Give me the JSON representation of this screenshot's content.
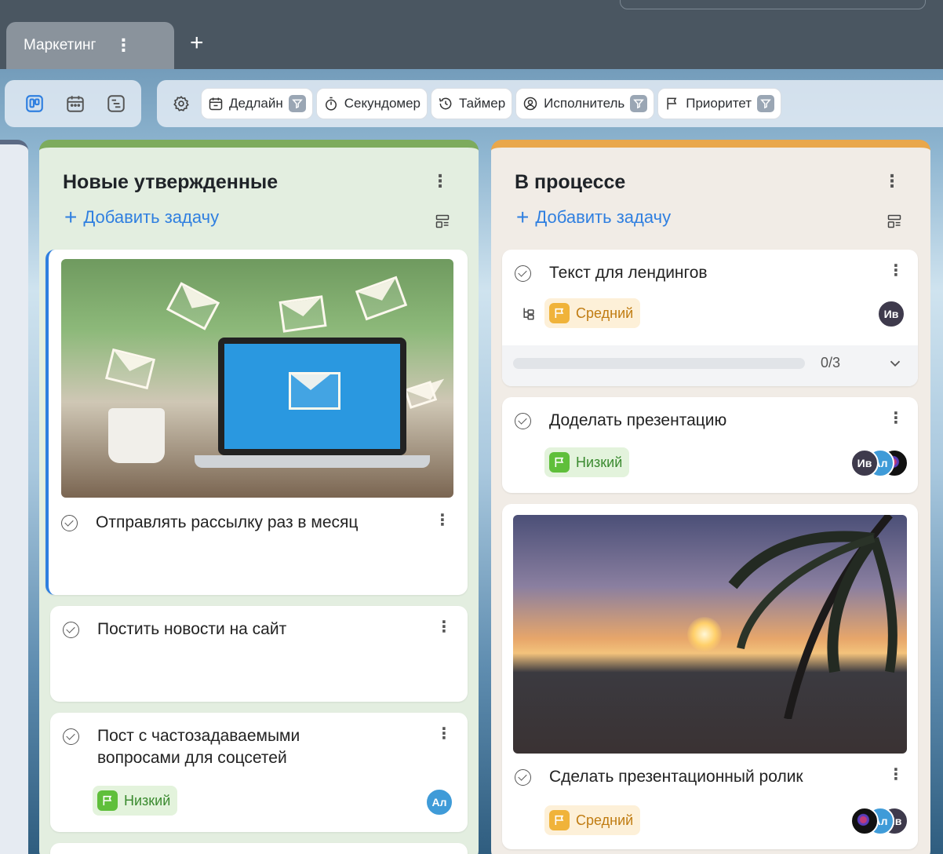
{
  "tabs": [
    {
      "label": "Маркетинг",
      "menu": "⋮"
    }
  ],
  "tab_add": "+",
  "toolbar": {
    "views": [
      "kanban-view-icon",
      "calendar-view-icon",
      "list-view-icon"
    ],
    "settings_icon": "gear-icon",
    "filters": [
      {
        "label": "Дедлайн",
        "icon": "calendar-icon",
        "filter": true
      },
      {
        "label": "Секундомер",
        "icon": "stopwatch-icon",
        "filter": false
      },
      {
        "label": "Таймер",
        "icon": "timer-icon",
        "filter": false
      },
      {
        "label": "Исполнитель",
        "icon": "user-icon",
        "filter": true
      },
      {
        "label": "Приоритет",
        "icon": "flag-icon",
        "filter": true
      }
    ]
  },
  "columns": [
    {
      "title": "Новые утвержденные",
      "menu": "⋮",
      "add_task": "Добавить задачу",
      "accent": "#7dab5d",
      "cards": [
        {
          "title": "Отправлять рассылку раз в месяц",
          "menu": "⋮",
          "image": "email-laptop-image"
        },
        {
          "title": "Постить новости на сайт",
          "menu": "⋮"
        },
        {
          "title": "Пост с частозадаваемыми вопросами для соцсетей",
          "title_line2": "вопросами для соцсетей",
          "title_line1": "Пост с частозадаваемыми",
          "menu": "⋮",
          "priority": "Низкий",
          "assignees": [
            "Ал"
          ]
        }
      ]
    },
    {
      "title": "В процессе",
      "menu": "⋮",
      "add_task": "Добавить задачу",
      "accent": "#e9a74b",
      "cards": [
        {
          "title": "Текст для лендингов",
          "menu": "⋮",
          "priority": "Средний",
          "assignees": [
            "Ив"
          ],
          "subtasks_done": 0,
          "subtasks_total": 3,
          "subtasks_text": "0/3"
        },
        {
          "title": "Доделать презентацию",
          "menu": "⋮",
          "priority": "Низкий",
          "assignees": [
            "Ив",
            "Ал",
            ""
          ]
        },
        {
          "title": "Сделать презентационный ролик",
          "menu": "⋮",
          "priority": "Средний",
          "assignees": [
            "",
            "Ал",
            "Ив"
          ],
          "image": "beach-sunset-image"
        }
      ]
    }
  ],
  "colors": {
    "accent_blue": "#2f7fe0",
    "priority_low": "#5fbf3b",
    "priority_mid": "#f0b33a"
  }
}
